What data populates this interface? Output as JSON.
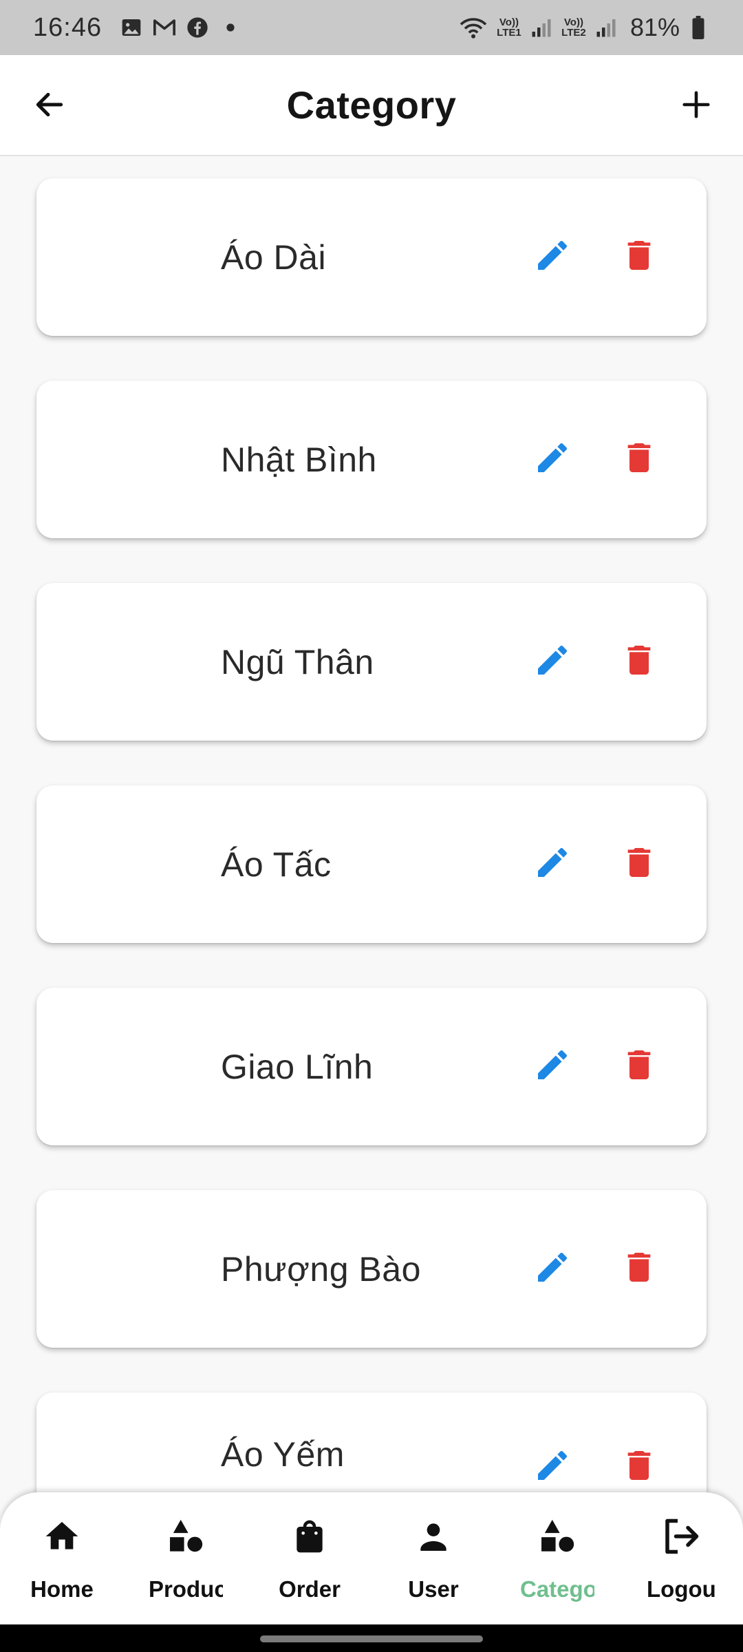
{
  "status_bar": {
    "time": "16:46",
    "left_icons": [
      "gallery-icon",
      "gmail-icon",
      "facebook-icon",
      "dot-icon"
    ],
    "sim1_label": "Vo)) LTE1",
    "sim2_label": "Vo)) LTE2",
    "battery": "81%"
  },
  "header": {
    "title": "Category",
    "back_icon": "arrow-left-icon",
    "add_icon": "plus-icon"
  },
  "colors": {
    "edit": "#1e88e5",
    "delete": "#e53935",
    "active_nav": "#6fbf8e"
  },
  "categories": [
    {
      "name": "Áo Dài"
    },
    {
      "name": "Nhật Bình"
    },
    {
      "name": "Ngũ Thân"
    },
    {
      "name": "Áo Tấc"
    },
    {
      "name": "Giao Lĩnh"
    },
    {
      "name": "Phượng Bào"
    },
    {
      "name": "Áo Yếm"
    }
  ],
  "bottom_nav": {
    "items": [
      {
        "label": "Home",
        "icon": "home-icon",
        "active": false
      },
      {
        "label": "Product",
        "icon": "shapes-icon",
        "active": false
      },
      {
        "label": "Order",
        "icon": "shopping-bag-icon",
        "active": false
      },
      {
        "label": "User",
        "icon": "person-icon",
        "active": false
      },
      {
        "label": "Category",
        "icon": "shapes-icon",
        "active": true
      },
      {
        "label": "Logout",
        "icon": "logout-icon",
        "active": false
      }
    ]
  }
}
